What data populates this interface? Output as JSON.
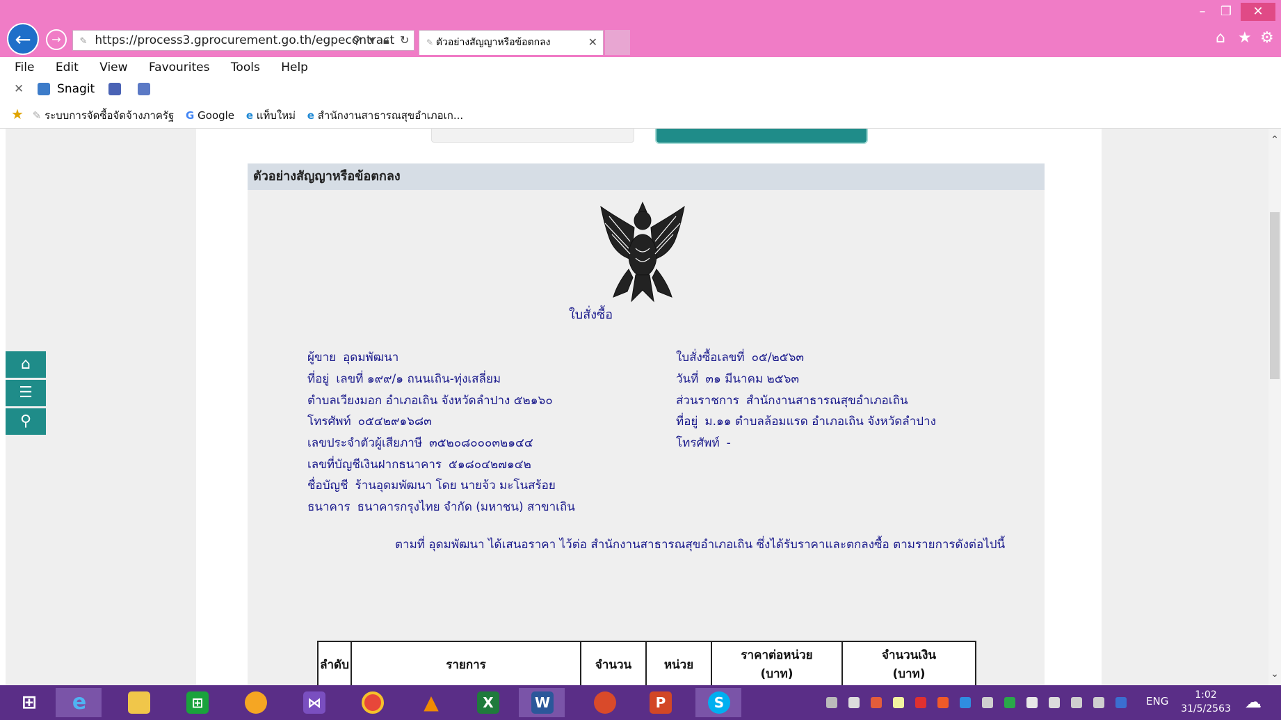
{
  "browser": {
    "url": "https://process3.gprocurement.go.th/egpecontract",
    "tab_title": "ตัวอย่างสัญญาหรือข้อตกลง",
    "window_controls": [
      "minimize-icon",
      "restore-icon",
      "close-icon"
    ],
    "toolbar_icons": [
      "home-icon",
      "star-icon",
      "gear-icon"
    ]
  },
  "menu": [
    "File",
    "Edit",
    "View",
    "Favourites",
    "Tools",
    "Help"
  ],
  "command_bar": {
    "snagit_label": "Snagit"
  },
  "favorites": [
    "ระบบการจัดซื้อจัดจ้างภาครัฐ",
    "Google",
    "แท็บใหม่",
    "สำนักงานสาธารณสุขอำเภอเก..."
  ],
  "side_tools": [
    "home-icon",
    "menu-icon",
    "search-icon"
  ],
  "panel": {
    "title": "ตัวอย่างสัญญาหรือข้อตกลง"
  },
  "document": {
    "title": "ใบสั่งซื้อ",
    "seller_label": "ผู้ขาย",
    "seller": "อุดมพัฒนา",
    "address_label": "ที่อยู่",
    "address": "เลขที่ ๑๙๙/๑ ถนนเถิน-ทุ่งเสลี่ยม",
    "address2": "ตำบลเวียงมอก อำเภอเถิน จังหวัดลำปาง ๕๒๑๖๐",
    "phone_label": "โทรศัพท์",
    "phone": "๐๕๔๒๙๑๖๘๓",
    "taxid_label": "เลขประจำตัวผู้เสียภาษี",
    "taxid": "๓๕๒๐๘๐๐๐๓๒๑๔๔",
    "bank_acct_label": "เลขที่บัญชีเงินฝากธนาคาร",
    "bank_acct": "๕๑๘๐๔๒๗๑๔๒",
    "acct_name_label": "ชื่อบัญชี",
    "acct_name": "ร้านอุดมพัฒนา โดย นายจ้ว มะโนสร้อย",
    "bank_label": "ธนาคาร",
    "bank": "ธนาคารกรุงไทย จำกัด (มหาชน) สาขาเถิน",
    "po_no_label": "ใบสั่งซื้อเลขที่",
    "po_no": "๐๕/๒๕๖๓",
    "date_label": "วันที่",
    "date": "๓๑ มีนาคม ๒๕๖๓",
    "agency_label": "ส่วนราชการ",
    "agency": "สำนักงานสาธารณสุขอำเภอเถิน",
    "agency_address_label": "ที่อยู่",
    "agency_address": "ม.๑๑ ตำบลล้อมแรด อำเภอเถิน จังหวัดลำปาง",
    "agency_phone_label": "โทรศัพท์",
    "agency_phone": "-",
    "intro": "ตามที่ อุดมพัฒนา ได้เสนอราคา ไว้ต่อ สำนักงานสาธารณสุขอำเภอเถิน ซึ่งได้รับราคาและตกลงซื้อ ตามรายการดังต่อไปนี้"
  },
  "table": {
    "headers": {
      "no": "ลำดับ",
      "item": "รายการ",
      "qty": "จำนวน",
      "unit": "หน่วย",
      "unit_price": "ราคาต่อหน่วย",
      "unit_price_sub": "(บาท)",
      "amount": "จำนวนเงิน",
      "amount_sub": "(บาท)"
    }
  },
  "taskbar": {
    "apps": [
      "windows-start-icon",
      "internet-explorer-icon",
      "file-explorer-icon",
      "store-icon",
      "media-icon",
      "visual-studio-icon",
      "chrome-icon",
      "vlc-icon",
      "excel-icon",
      "word-icon",
      "app-icon",
      "powerpoint-icon",
      "skype-icon"
    ],
    "app_letters": [
      "X",
      "W",
      "P",
      "S"
    ],
    "lang": "ENG",
    "time": "1:02",
    "date": "31/5/2563"
  },
  "colors": {
    "chrome": "#f07cc6",
    "taskbar": "#5a2e87",
    "teal": "#1f8c89",
    "doc_text": "#1a1a8c"
  }
}
